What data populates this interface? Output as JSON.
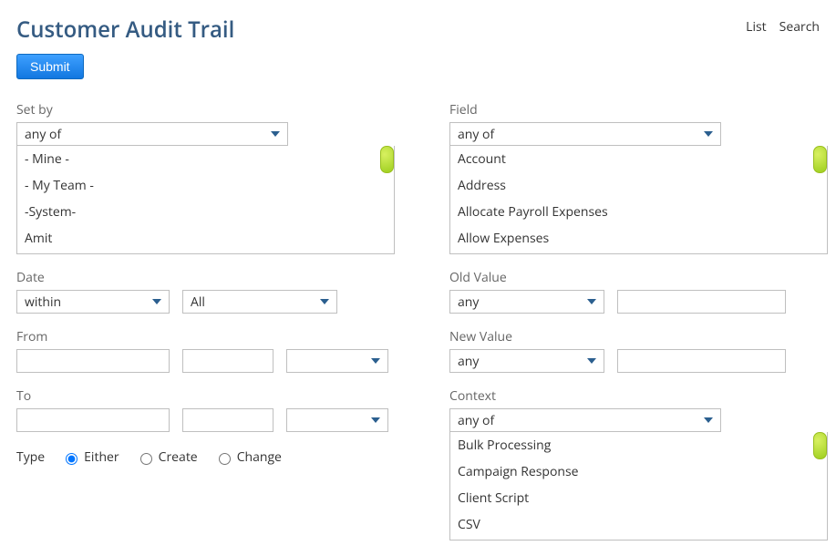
{
  "header": {
    "title": "Customer Audit Trail",
    "links": {
      "list": "List",
      "search": "Search"
    }
  },
  "buttons": {
    "submit": "Submit"
  },
  "left": {
    "set_by": {
      "label": "Set by",
      "selected": "any of",
      "options": [
        "- Mine -",
        "- My Team -",
        "-System-",
        "Amit"
      ]
    },
    "date": {
      "label": "Date",
      "mode": "within",
      "range": "All"
    },
    "from": {
      "label": "From"
    },
    "to": {
      "label": "To"
    },
    "type": {
      "label": "Type",
      "options": {
        "either": "Either",
        "create": "Create",
        "change": "Change"
      },
      "selected": "either"
    }
  },
  "right": {
    "field": {
      "label": "Field",
      "selected": "any of",
      "options": [
        "Account",
        "Address",
        "Allocate Payroll Expenses",
        "Allow Expenses"
      ]
    },
    "old_value": {
      "label": "Old Value",
      "mode": "any"
    },
    "new_value": {
      "label": "New Value",
      "mode": "any"
    },
    "context": {
      "label": "Context",
      "selected": "any of",
      "options": [
        "Bulk Processing",
        "Campaign Response",
        "Client Script",
        "CSV"
      ]
    }
  }
}
